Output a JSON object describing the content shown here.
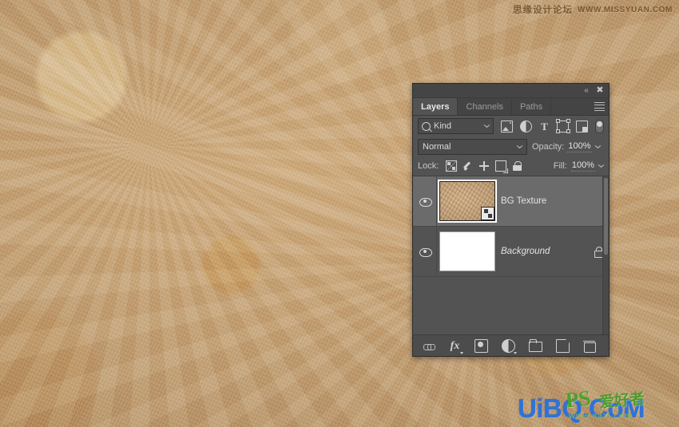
{
  "canvas": {
    "background_name": "leather-texture-canvas",
    "base_color": "#c0a077"
  },
  "watermarks": {
    "top": {
      "chinese": "思缘设计论坛",
      "english": "WWW.MISSYUAN.COM",
      "color": "#6a4a28"
    },
    "bottom": {
      "site": "UiBQ.CoM",
      "logo": "PS",
      "logo_cn": "爱好者",
      "sub": "www.sazi.com",
      "site_color": "#2f72d8",
      "logo_color": "#4aa32a"
    }
  },
  "panel": {
    "titlebar": {
      "collapse_icon": "double-chevron-left-icon",
      "close_icon": "close-icon"
    },
    "tabs": [
      {
        "label": "Layers",
        "active": true
      },
      {
        "label": "Channels",
        "active": false
      },
      {
        "label": "Paths",
        "active": false
      }
    ],
    "menu_icon": "panel-menu-icon",
    "filter": {
      "search_icon": "magnifier-icon",
      "kind_label": "Kind",
      "dropdown_icon": "chevron-down-icon",
      "icons": [
        {
          "name": "filter-pixel-layers-icon",
          "glyph": "image"
        },
        {
          "name": "filter-adjustment-layers-icon",
          "glyph": "half-circle"
        },
        {
          "name": "filter-type-layers-icon",
          "glyph": "T"
        },
        {
          "name": "filter-shape-layers-icon",
          "glyph": "shape-box"
        },
        {
          "name": "filter-smart-objects-icon",
          "glyph": "smart-object"
        },
        {
          "name": "filter-enable-toggle",
          "glyph": "toggle-switch"
        }
      ]
    },
    "blend": {
      "mode": "Normal",
      "opacity_label": "Opacity:",
      "opacity_value": "100%",
      "fill_label": "Fill:",
      "fill_value": "100%"
    },
    "lock": {
      "label": "Lock:",
      "buttons": [
        {
          "name": "lock-transparent-pixels",
          "glyph": "checkerboard"
        },
        {
          "name": "lock-image-pixels",
          "glyph": "brush"
        },
        {
          "name": "lock-position",
          "glyph": "move-cross"
        },
        {
          "name": "lock-artboard-nesting",
          "glyph": "artboard"
        },
        {
          "name": "lock-all",
          "glyph": "padlock"
        }
      ]
    },
    "layers": [
      {
        "name": "BG Texture",
        "visible": true,
        "selected": true,
        "italic": false,
        "locked": false,
        "thumbnail": "texture",
        "smart_object": true
      },
      {
        "name": "Background",
        "visible": true,
        "selected": false,
        "italic": true,
        "locked": true,
        "thumbnail": "white",
        "smart_object": false
      }
    ],
    "footer": [
      {
        "name": "link-layers-button",
        "glyph": "link"
      },
      {
        "name": "add-layer-style-button",
        "glyph": "fx"
      },
      {
        "name": "add-layer-mask-button",
        "glyph": "mask"
      },
      {
        "name": "new-fill-adjustment-layer-button",
        "glyph": "adjustment"
      },
      {
        "name": "new-group-button",
        "glyph": "folder"
      },
      {
        "name": "new-layer-button",
        "glyph": "new-page"
      },
      {
        "name": "delete-layer-button",
        "glyph": "trash"
      }
    ]
  }
}
